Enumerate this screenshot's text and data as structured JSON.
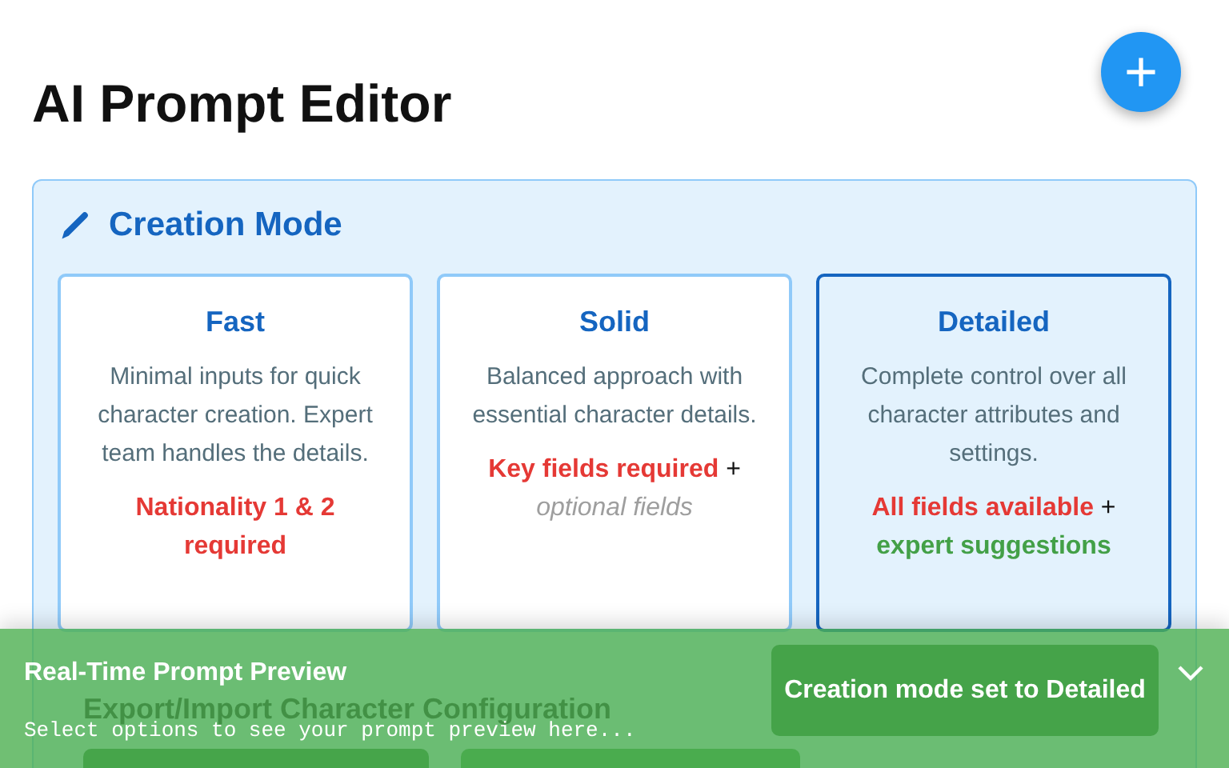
{
  "page": {
    "title": "AI Prompt Editor",
    "add_button": "+"
  },
  "creation_mode": {
    "title": "Creation Mode",
    "modes": [
      {
        "name": "Fast",
        "selected": false,
        "description": "Minimal inputs for quick character creation. Expert team handles the details.",
        "note": [
          {
            "kind": "required",
            "text": "Nationality 1 & 2 required"
          }
        ]
      },
      {
        "name": "Solid",
        "selected": false,
        "description": "Balanced approach with essential character details.",
        "note": [
          {
            "kind": "required",
            "text": "Key fields required"
          },
          {
            "kind": "plain",
            "text": " + "
          },
          {
            "kind": "optional",
            "text": "optional fields"
          }
        ]
      },
      {
        "name": "Detailed",
        "selected": true,
        "description": "Complete control over all character attributes and settings.",
        "note": [
          {
            "kind": "required",
            "text": "All fields available"
          },
          {
            "kind": "plain",
            "text": " + "
          },
          {
            "kind": "suggestion",
            "text": "expert suggestions"
          }
        ]
      }
    ]
  },
  "export_section": {
    "title": "Export/Import Character Configuration"
  },
  "toast": {
    "message": "Creation mode set to Detailed"
  },
  "preview": {
    "title": "Real-Time Prompt Preview",
    "expanded": false,
    "text": "Select options to see your prompt preview here..."
  }
}
